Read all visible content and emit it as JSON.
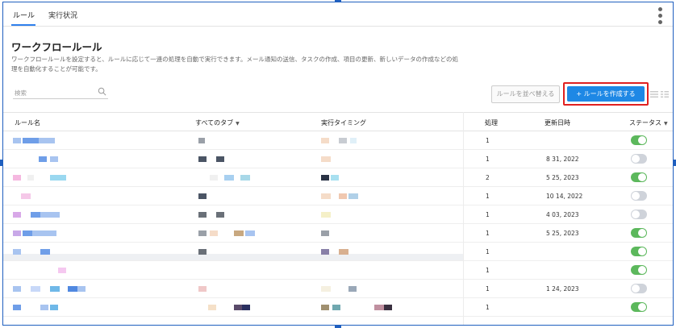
{
  "tabs": [
    {
      "label": "ルール",
      "active": true
    },
    {
      "label": "実行状況",
      "active": false
    }
  ],
  "page": {
    "title": "ワークフロールール",
    "description": "ワークフロールールを設定すると、ルールに応じて一連の処理を自動で実行できます。メール通知の送信、タスクの作成、項目の更新、新しいデータの作成などの処理を自動化することが可能です。"
  },
  "search": {
    "placeholder": "検索"
  },
  "buttons": {
    "reorder": "ルールを並べ替える",
    "create": "+ ルールを作成する"
  },
  "table": {
    "headers": {
      "rule_name": "ルール名",
      "all_types": "すべてのタブ",
      "timing": "実行タイミング",
      "process": "処理",
      "updated": "更新日時",
      "status": "ステータス"
    },
    "rows": [
      {
        "process": "1",
        "updated": "",
        "status": "on"
      },
      {
        "process": "1",
        "updated": "8 31, 2022",
        "status": "off"
      },
      {
        "process": "2",
        "updated": "5 25, 2023",
        "status": "on"
      },
      {
        "process": "1",
        "updated": "10 14, 2022",
        "status": "off"
      },
      {
        "process": "1",
        "updated": "4 03, 2023",
        "status": "off"
      },
      {
        "process": "1",
        "updated": "5 25, 2023",
        "status": "on"
      },
      {
        "process": "1",
        "updated": "",
        "status": "on"
      },
      {
        "process": "1",
        "updated": "",
        "status": "on"
      },
      {
        "process": "1",
        "updated": "1 24, 2023",
        "status": "off"
      },
      {
        "process": "1",
        "updated": "",
        "status": "on"
      }
    ]
  },
  "colors": {
    "accent": "#1e88e5",
    "highlight": "#e02020",
    "toggle_on": "#5cb85c",
    "toggle_off": "#cfd3da"
  }
}
